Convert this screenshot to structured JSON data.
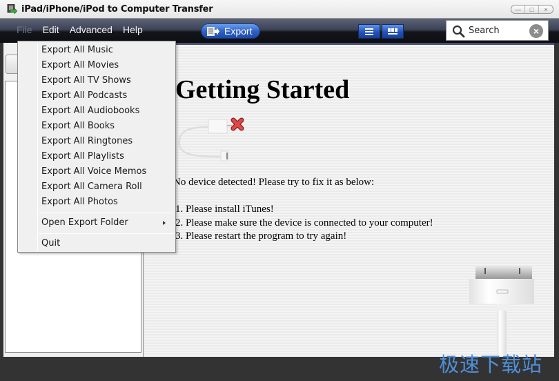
{
  "window": {
    "title": "iPad/iPhone/iPod to Computer Transfer",
    "controls": [
      "minimize",
      "maximize",
      "close"
    ]
  },
  "menubar": {
    "items": [
      "File",
      "Edit",
      "Advanced",
      "Help"
    ],
    "active": "File"
  },
  "toolbar": {
    "export_label": "Export",
    "view_buttons": [
      "list-view",
      "grid-view"
    ],
    "search_placeholder": "Search"
  },
  "file_menu": {
    "items": [
      "Export All Music",
      "Export All Movies",
      "Export All TV Shows",
      "Export All Podcasts",
      "Export All Audiobooks",
      "Export All Books",
      "Export All Ringtones",
      "Export All Playlists",
      "Export All Voice Memos",
      "Export All Camera Roll",
      "Export All Photos"
    ],
    "open_folder": "Open Export Folder",
    "quit": "Quit"
  },
  "main": {
    "heading": "Getting Started",
    "message": "No device detected! Please try to fix it as below:",
    "steps": [
      "1. Please install iTunes!",
      "2. Please make sure the device is connected to your computer!",
      "3. Please restart the program to try again!"
    ]
  },
  "watermark": "极速下载站",
  "colors": {
    "accent_blue": "#2f62c6",
    "error_red": "#d9393a"
  }
}
